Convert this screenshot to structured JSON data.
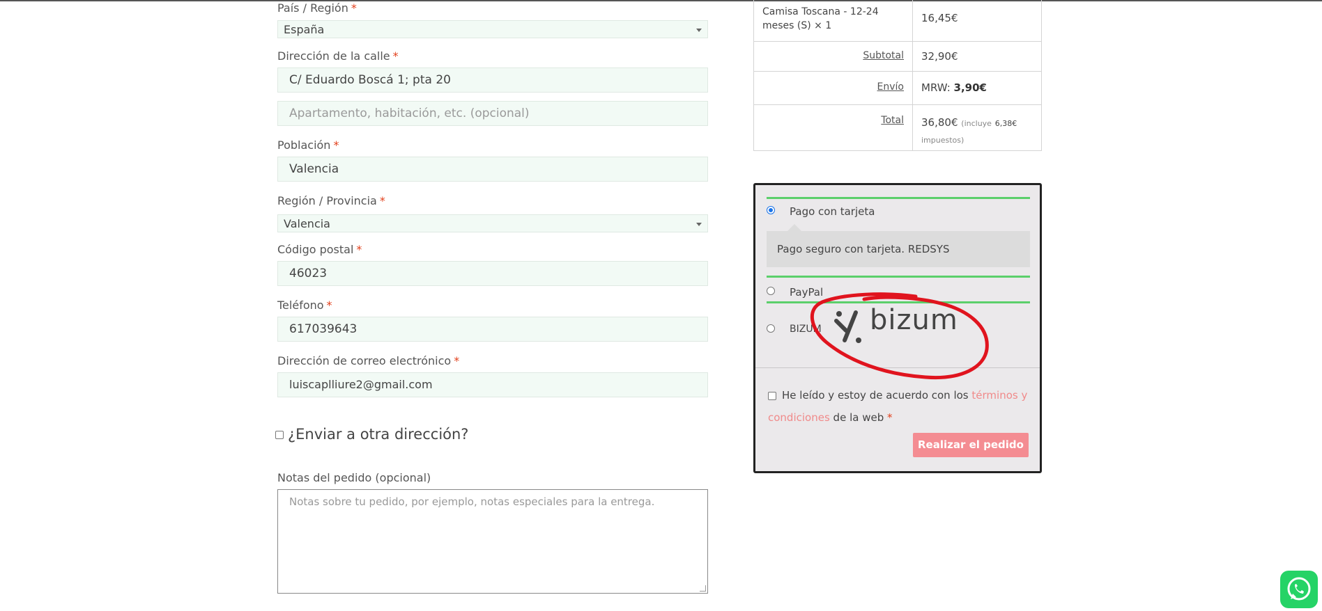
{
  "form": {
    "country": {
      "label": "País / Región",
      "required": "*",
      "value": "España"
    },
    "street": {
      "label": "Dirección de la calle",
      "required": "*",
      "value": "C/ Eduardo Boscá 1; pta 20",
      "placeholder2": "Apartamento, habitación, etc. (opcional)"
    },
    "city": {
      "label": "Población",
      "required": "*",
      "value": "Valencia"
    },
    "region": {
      "label": "Región / Provincia",
      "required": "*",
      "value": "Valencia"
    },
    "postcode": {
      "label": "Código postal",
      "required": "*",
      "value": "46023"
    },
    "phone": {
      "label": "Teléfono",
      "required": "*",
      "value": "617039643"
    },
    "email": {
      "label": "Dirección de correo electrónico",
      "required": "*",
      "value": "luiscaplliure2@gmail.com"
    },
    "ship_different": "¿Enviar a otra dirección?",
    "notes": {
      "label": "Notas del pedido (opcional)",
      "placeholder": "Notas sobre tu pedido, por ejemplo, notas especiales para la entrega."
    }
  },
  "order": {
    "item_name": "Camisa Toscana - 12-24 meses (S)",
    "item_qty": "× 1",
    "item_price": "16,45€",
    "subtotal_label": "Subtotal",
    "subtotal_value": "32,90€",
    "shipping_label": "Envío",
    "shipping_method": "MRW:",
    "shipping_value": "3,90€",
    "total_label": "Total",
    "total_value": "36,80€",
    "tax_note_prefix": "(incluye",
    "tax_value": "6,38€",
    "tax_note_suffix": "impuestos)"
  },
  "payment": {
    "card_label": "Pago con tarjeta",
    "card_desc": "Pago seguro con tarjeta. REDSYS",
    "paypal_label": "PayPal",
    "bizum_label": "BIZUM",
    "bizum_logo_text": "bizum",
    "terms_prefix": "He leído y estoy de acuerdo con los",
    "terms_link": "términos y condiciones",
    "terms_suffix": "de la web",
    "terms_required": "*",
    "order_button": "Realizar el pedido"
  },
  "colors": {
    "accent_green": "#5bcf6b",
    "button_pink": "#f48c92",
    "link_pink": "#f08a8a",
    "required_red": "#e2401c",
    "annotation_red": "#e0141e",
    "whatsapp": "#25d366"
  },
  "icons": [
    "chevron-down-icon",
    "whatsapp-icon",
    "bizum-logo"
  ]
}
